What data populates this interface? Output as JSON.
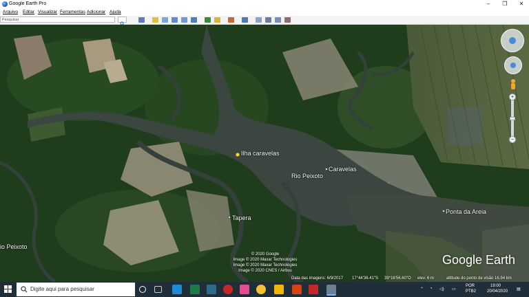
{
  "window": {
    "title": "Google Earth Pro",
    "minimize_label": "–",
    "maximize_label": "❐",
    "close_label": "✕"
  },
  "menu": [
    "Arquivo",
    "Editar",
    "Visualizar",
    "Ferramentas",
    "Adicionar",
    "Ajuda"
  ],
  "search": {
    "value": "Pesquisar"
  },
  "map": {
    "labels": {
      "ilha": "Ilha caravelas",
      "caravelas": "Caravelas",
      "rio_peixoto": "Rio Peixoto",
      "rio_peixoto_left": "io Peixoto",
      "tapera": "Tapera",
      "ponta_da_areia": "Ponta da Areia"
    },
    "copyright": [
      "© 2020 Google",
      "Image © 2020 Maxar Technologies",
      "Image © 2020 Maxar Technologies",
      "Image © 2020 CNES / Airbus"
    ],
    "logo": "Google Earth",
    "status": {
      "imagery_date": "Data das imagens: 6/9/2017",
      "lat": "17°44'36.41\"S",
      "lon": "39°16'56.60\"O",
      "elevation": "elev.   6 m",
      "eye_alt": "altitude do ponto de visão  16.94 km"
    }
  },
  "taskbar": {
    "search_placeholder": "Digite aqui para pesquisar",
    "lang_top": "POR",
    "lang_bottom": "PTB2",
    "time": "19:00",
    "date": "20/04/2020"
  },
  "colors": {
    "taskbar": "#202e3a",
    "river": "#3b4640",
    "forest": "#1f3d1c"
  }
}
